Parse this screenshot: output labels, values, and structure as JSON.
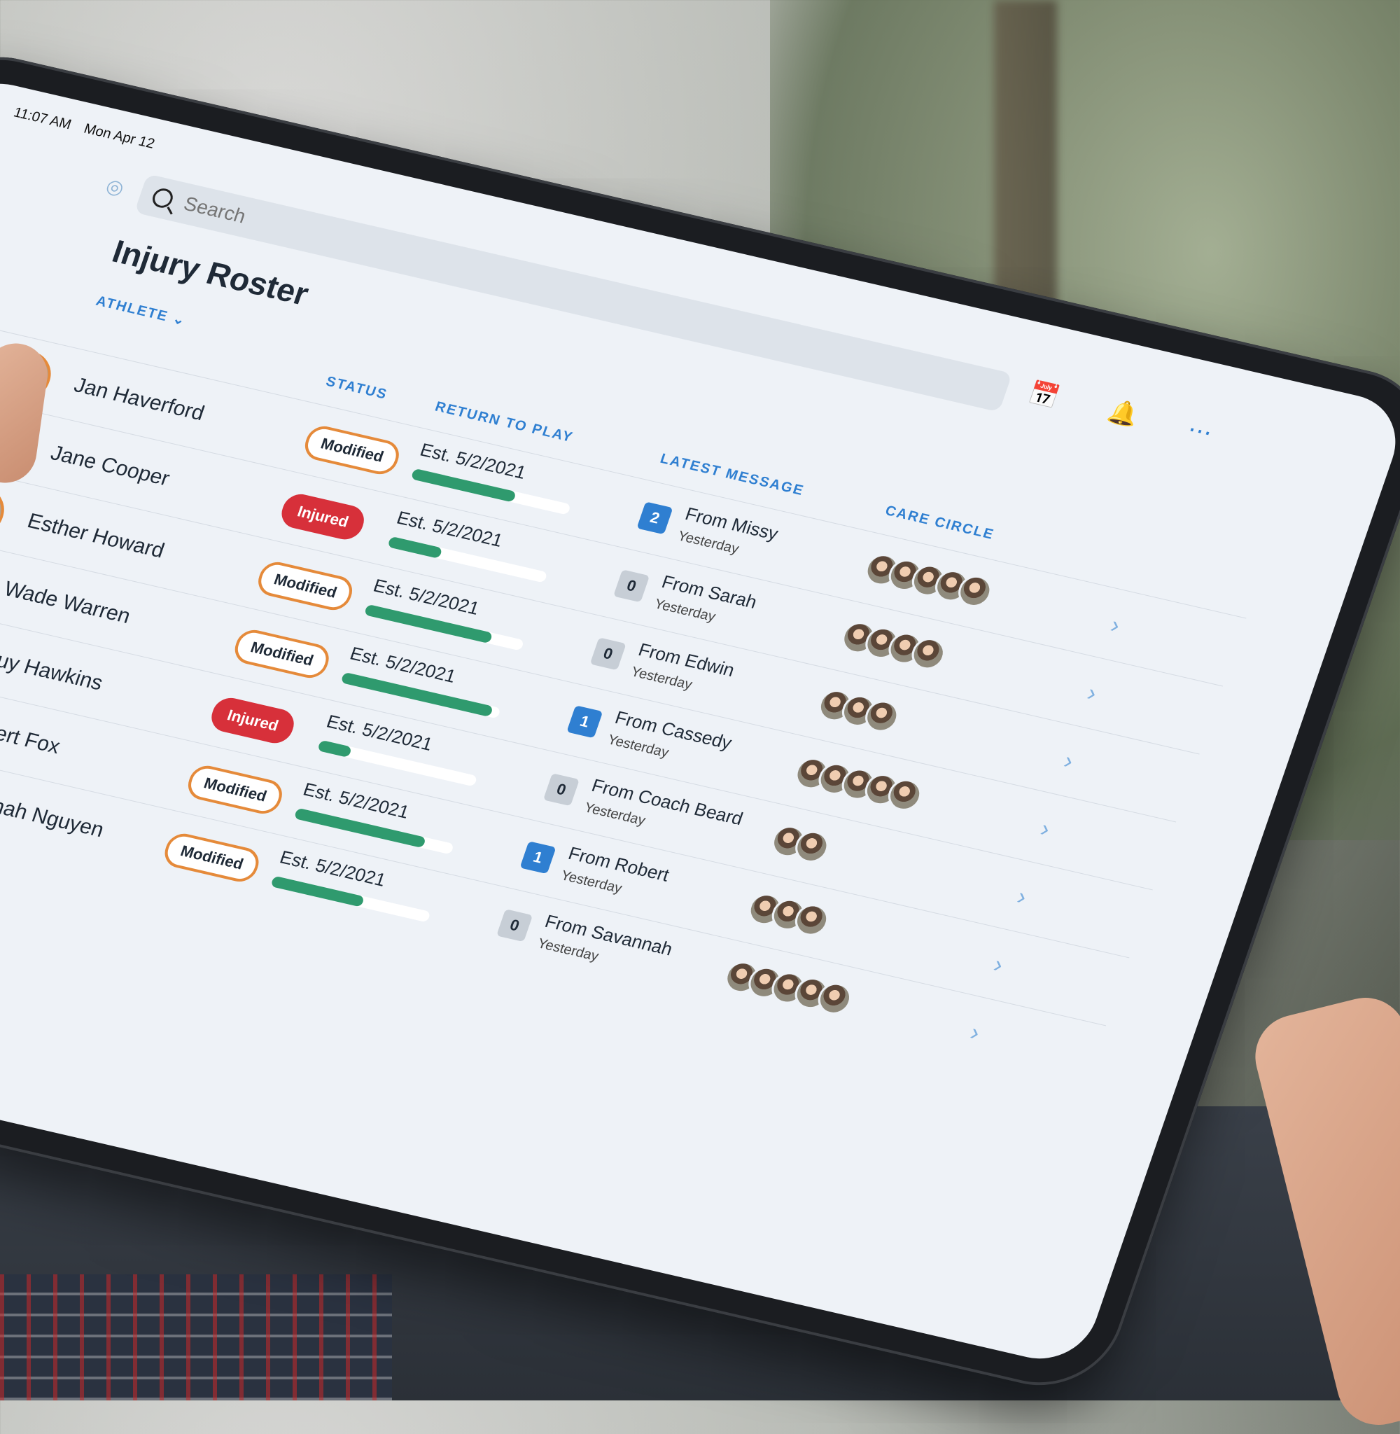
{
  "status_bar": {
    "time": "11:07 AM",
    "date": "Mon Apr 12"
  },
  "search": {
    "placeholder": "Search"
  },
  "toolbar": {
    "calendar_icon": "calendar-icon",
    "bell_icon": "bell-icon",
    "more_icon": "more-icon"
  },
  "page": {
    "title": "Injury Roster"
  },
  "columns": {
    "athlete": "ATHLETE",
    "status": "STATUS",
    "return_to_play": "RETURN TO PLAY",
    "latest_message": "LATEST MESSAGE",
    "care_circle": "CARE CIRCLE"
  },
  "colors": {
    "accent": "#2f7fd1",
    "progress": "#2f9a6e",
    "modified": "#e58a3a",
    "injured": "#d7303a"
  },
  "rows": [
    {
      "name": "Jan Haverford",
      "status": "Modified",
      "rtp": "Est. 5/2/2021",
      "progress": 0.65,
      "badge": "2",
      "badge_style": "blue",
      "from": "From Missy",
      "when": "Yesterday",
      "care_count": 5
    },
    {
      "name": "Jane Cooper",
      "status": "Injured",
      "rtp": "Est. 5/2/2021",
      "progress": 0.33,
      "badge": "0",
      "badge_style": "gray",
      "from": "From Sarah",
      "when": "Yesterday",
      "care_count": 4
    },
    {
      "name": "Esther Howard",
      "status": "Modified",
      "rtp": "Est. 5/2/2021",
      "progress": 0.8,
      "badge": "0",
      "badge_style": "gray",
      "from": "From Edwin",
      "when": "Yesterday",
      "care_count": 3
    },
    {
      "name": "Wade Warren",
      "status": "Modified",
      "rtp": "Est. 5/2/2021",
      "progress": 0.95,
      "badge": "1",
      "badge_style": "blue",
      "from": "From Cassedy",
      "when": "Yesterday",
      "care_count": 5
    },
    {
      "name": "Guy Hawkins",
      "status": "Injured",
      "rtp": "Est. 5/2/2021",
      "progress": 0.2,
      "badge": "0",
      "badge_style": "gray",
      "from": "From Coach Beard",
      "when": "Yesterday",
      "care_count": 2
    },
    {
      "name": "Robert Fox",
      "status": "Modified",
      "rtp": "Est. 5/2/2021",
      "progress": 0.82,
      "badge": "1",
      "badge_style": "blue",
      "from": "From Robert",
      "when": "Yesterday",
      "care_count": 3
    },
    {
      "name": "Savannah Nguyen",
      "status": "Modified",
      "rtp": "Est. 5/2/2021",
      "progress": 0.58,
      "badge": "0",
      "badge_style": "gray",
      "from": "From Savannah",
      "when": "Yesterday",
      "care_count": 5
    }
  ]
}
